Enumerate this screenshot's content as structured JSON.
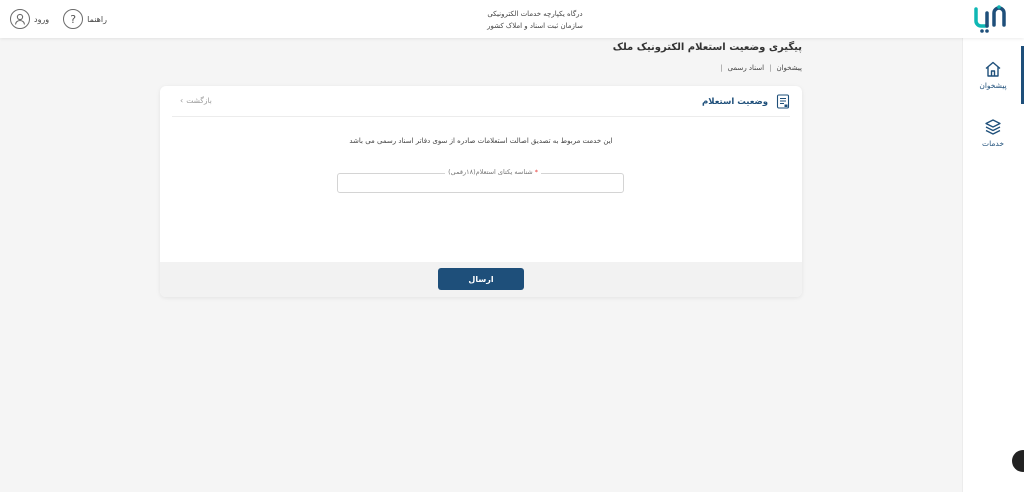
{
  "header": {
    "logo_text": "ثبت من",
    "title_line1": "درگاه یکپارچه خدمات الکترونیکی",
    "title_line2": "سازمان ثبت اسناد و املاک کشور",
    "help_label": "راهنما",
    "help_glyph": "?",
    "login_label": "ورود"
  },
  "sidebar": {
    "items": [
      {
        "label": "پیشخوان",
        "icon": "home-icon",
        "active": true
      },
      {
        "label": "خدمات",
        "icon": "layers-icon",
        "active": false
      }
    ]
  },
  "page": {
    "title": "پیگیری وضعیت استعلام الکترونیک ملک",
    "breadcrumb": [
      "پیشخوان",
      "اسناد رسمی"
    ]
  },
  "card": {
    "heading": "وضعیت استعلام",
    "back_label": "بازگشت",
    "intro": "این خدمت مربوط به تصدیق اصالت استعلامات صادره از سوی دفاتر اسناد رسمی می باشد",
    "field": {
      "label": "شناسه یکتای استعلام(۱۸رقمی)",
      "required_mark": "*",
      "value": ""
    },
    "submit_label": "ارسال"
  },
  "colors": {
    "primary": "#1e4f7a",
    "required": "#e53935",
    "background": "#f5f5f5"
  }
}
